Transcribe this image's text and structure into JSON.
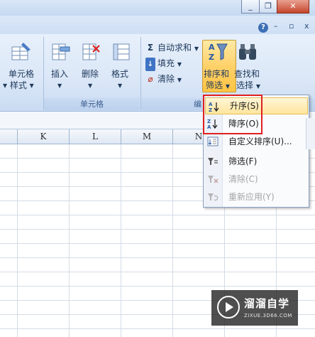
{
  "window": {
    "minimize": "_",
    "restore": "❐",
    "close": "✕"
  },
  "tabrow": {
    "help": "?",
    "min": "–",
    "restore": "▫",
    "close": "x"
  },
  "ribbon": {
    "cells_group": {
      "label": "单元格",
      "cell_style": {
        "line1": "单元格",
        "line2": "样式"
      },
      "insert": "插入",
      "delete": "删除",
      "format": "格式"
    },
    "editing_group": {
      "label": "编",
      "autosum": "自动求和",
      "fill": "填充",
      "clear": "清除",
      "sort_filter": {
        "line1": "排序和",
        "line2": "筛选"
      },
      "find_select": {
        "line1": "查找和",
        "line2": "选择"
      }
    }
  },
  "columns": [
    "K",
    "L",
    "M",
    "N"
  ],
  "menu": {
    "items": [
      {
        "icon": "sort-ascending-icon",
        "label": "升序(S)",
        "disabled": false
      },
      {
        "icon": "sort-descending-icon",
        "label": "降序(O)",
        "disabled": false
      },
      {
        "icon": "custom-sort-icon",
        "label": "自定义排序(U)...",
        "disabled": false
      },
      {
        "icon": "filter-icon",
        "label": "筛选(F)",
        "disabled": false
      },
      {
        "icon": "clear-filter-icon",
        "label": "清除(C)",
        "disabled": true
      },
      {
        "icon": "reapply-icon",
        "label": "重新应用(Y)",
        "disabled": true
      }
    ]
  },
  "watermark": {
    "title": "溜溜自学",
    "subtitle": "ZIXUE.3D66.COM"
  },
  "colors": {
    "highlight_border": "#e02020",
    "ribbon_bg": "#dbe7f7",
    "active_button": "#ffd16a"
  }
}
